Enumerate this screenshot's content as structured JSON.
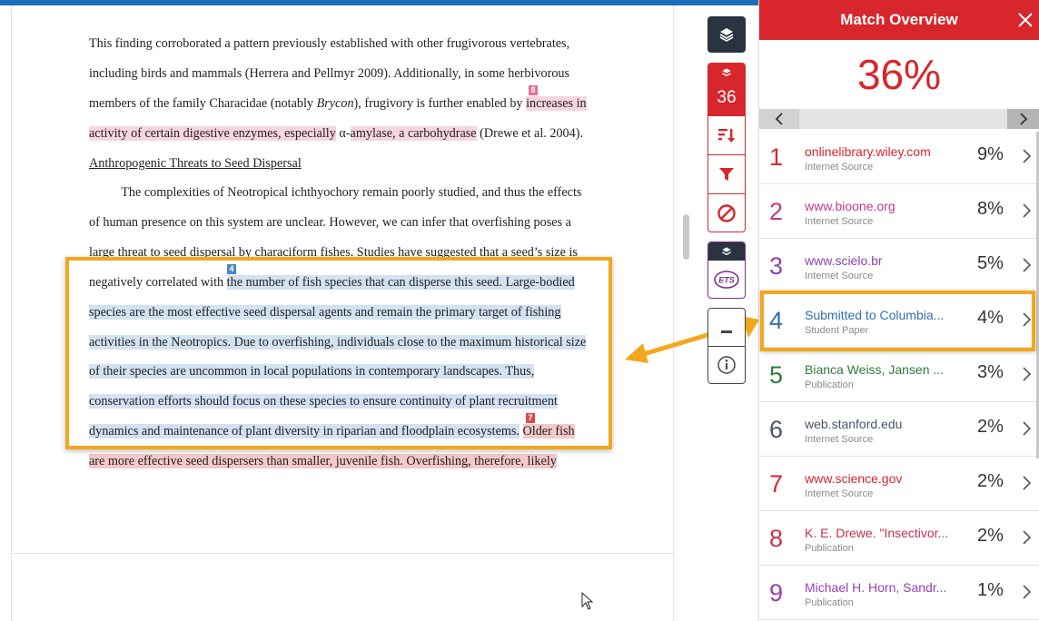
{
  "document": {
    "lines": [
      {
        "segments": [
          {
            "t": "This finding corroborated a pattern previously established with other frugivorous vertebrates,"
          }
        ]
      },
      {
        "segments": [
          {
            "t": "including birds and mammals (Herrera and Pellmyr 2009). Additionally, in some herbivorous"
          }
        ]
      },
      {
        "segments": [
          {
            "t": "members of the family Characidae (notably "
          },
          {
            "t": "Brycon",
            "italic": true
          },
          {
            "t": "), frugivory is further enabled by "
          },
          {
            "t": "increases in",
            "hl": "pink"
          }
        ]
      },
      {
        "segments": [
          {
            "t": "activity of certain digestive enzymes, especially",
            "hl": "pink"
          },
          {
            "t": " α-"
          },
          {
            "t": "amylase, a carbohydrase",
            "hl": "pink"
          },
          {
            "t": " (Drewe et al. 2004)."
          }
        ]
      },
      {
        "segments": [
          {
            "t": "Anthropogenic Threats to Seed Dispersal",
            "underline": true
          }
        ]
      },
      {
        "segments": [
          {
            "t": "          The complexities of Neotropical ichthyochory remain poorly studied, and thus the effects"
          }
        ]
      },
      {
        "segments": [
          {
            "t": "of human presence on this system are unclear. However, we can infer that overfishing poses a"
          }
        ]
      },
      {
        "segments": [
          {
            "t": "large threat to seed dispersal by characiform fishes. Studies have suggested that a seed’s size is"
          }
        ]
      },
      {
        "segments": [
          {
            "t": "negatively correlated with "
          },
          {
            "t": "the number of fish species that can disperse this seed. Large-bodied",
            "hl": "blue"
          }
        ]
      },
      {
        "segments": [
          {
            "t": "species are the most effective seed dispersal agents and remain the primary target of fishing",
            "hl": "blue"
          }
        ]
      },
      {
        "segments": [
          {
            "t": "activities in the Neotropics. Due to overfishing, individuals close to the maximum historical size",
            "hl": "blue"
          }
        ]
      },
      {
        "segments": [
          {
            "t": "of their species are uncommon in local populations in contemporary landscapes. Thus,",
            "hl": "blue"
          }
        ]
      },
      {
        "segments": [
          {
            "t": "conservation efforts should focus on these species to ensure continuity of plant recruitment",
            "hl": "blue"
          }
        ]
      },
      {
        "segments": [
          {
            "t": "dynamics and maintenance of plant diversity in riparian and floodplain ecosystems.",
            "hl": "blue"
          },
          {
            "t": " "
          },
          {
            "t": "Older fish",
            "hl": "red"
          }
        ]
      },
      {
        "segments": [
          {
            "t": "are more effective seed dispersers than smaller, juvenile fish. Overfishing, therefore, likely",
            "hl": "red"
          }
        ]
      }
    ],
    "badges": [
      {
        "label": "8",
        "color": "pink"
      },
      {
        "label": "4",
        "color": "blue"
      },
      {
        "label": "7",
        "color": "red"
      }
    ]
  },
  "toolbar": {
    "match_count": "36",
    "ets_label": "ETS"
  },
  "panel": {
    "title": "Match Overview",
    "overall_percent": "36%",
    "matches": [
      {
        "num": "1",
        "source": "onlinelibrary.wiley.com",
        "type": "Internet Source",
        "percent": "9%",
        "color": "#d8262d"
      },
      {
        "num": "2",
        "source": "www.bioone.org",
        "type": "Internet Source",
        "percent": "8%",
        "color": "#c13a86"
      },
      {
        "num": "3",
        "source": "www.scielo.br",
        "type": "Internet Source",
        "percent": "5%",
        "color": "#8e44ad"
      },
      {
        "num": "4",
        "source": "Submitted to Columbia...",
        "type": "Student Paper",
        "percent": "4%",
        "color": "#2f6fb5"
      },
      {
        "num": "5",
        "source": "Bianca Weiss, Jansen ...",
        "type": "Publication",
        "percent": "3%",
        "color": "#2e7d32"
      },
      {
        "num": "6",
        "source": "web.stanford.edu",
        "type": "Internet Source",
        "percent": "2%",
        "color": "#4a5568"
      },
      {
        "num": "7",
        "source": "www.science.gov",
        "type": "Internet Source",
        "percent": "2%",
        "color": "#d8262d"
      },
      {
        "num": "8",
        "source": "K. E. Drewe. \"Insectivor...",
        "type": "Publication",
        "percent": "2%",
        "color": "#c8324e"
      },
      {
        "num": "9",
        "source": "Michael H. Horn, Sandr...",
        "type": "Publication",
        "percent": "1%",
        "color": "#9b3fb5"
      }
    ]
  },
  "colors": {
    "accent_red": "#d8262d",
    "highlight_orange": "#f3a71d",
    "top_bar_blue": "#1f6fb6"
  }
}
